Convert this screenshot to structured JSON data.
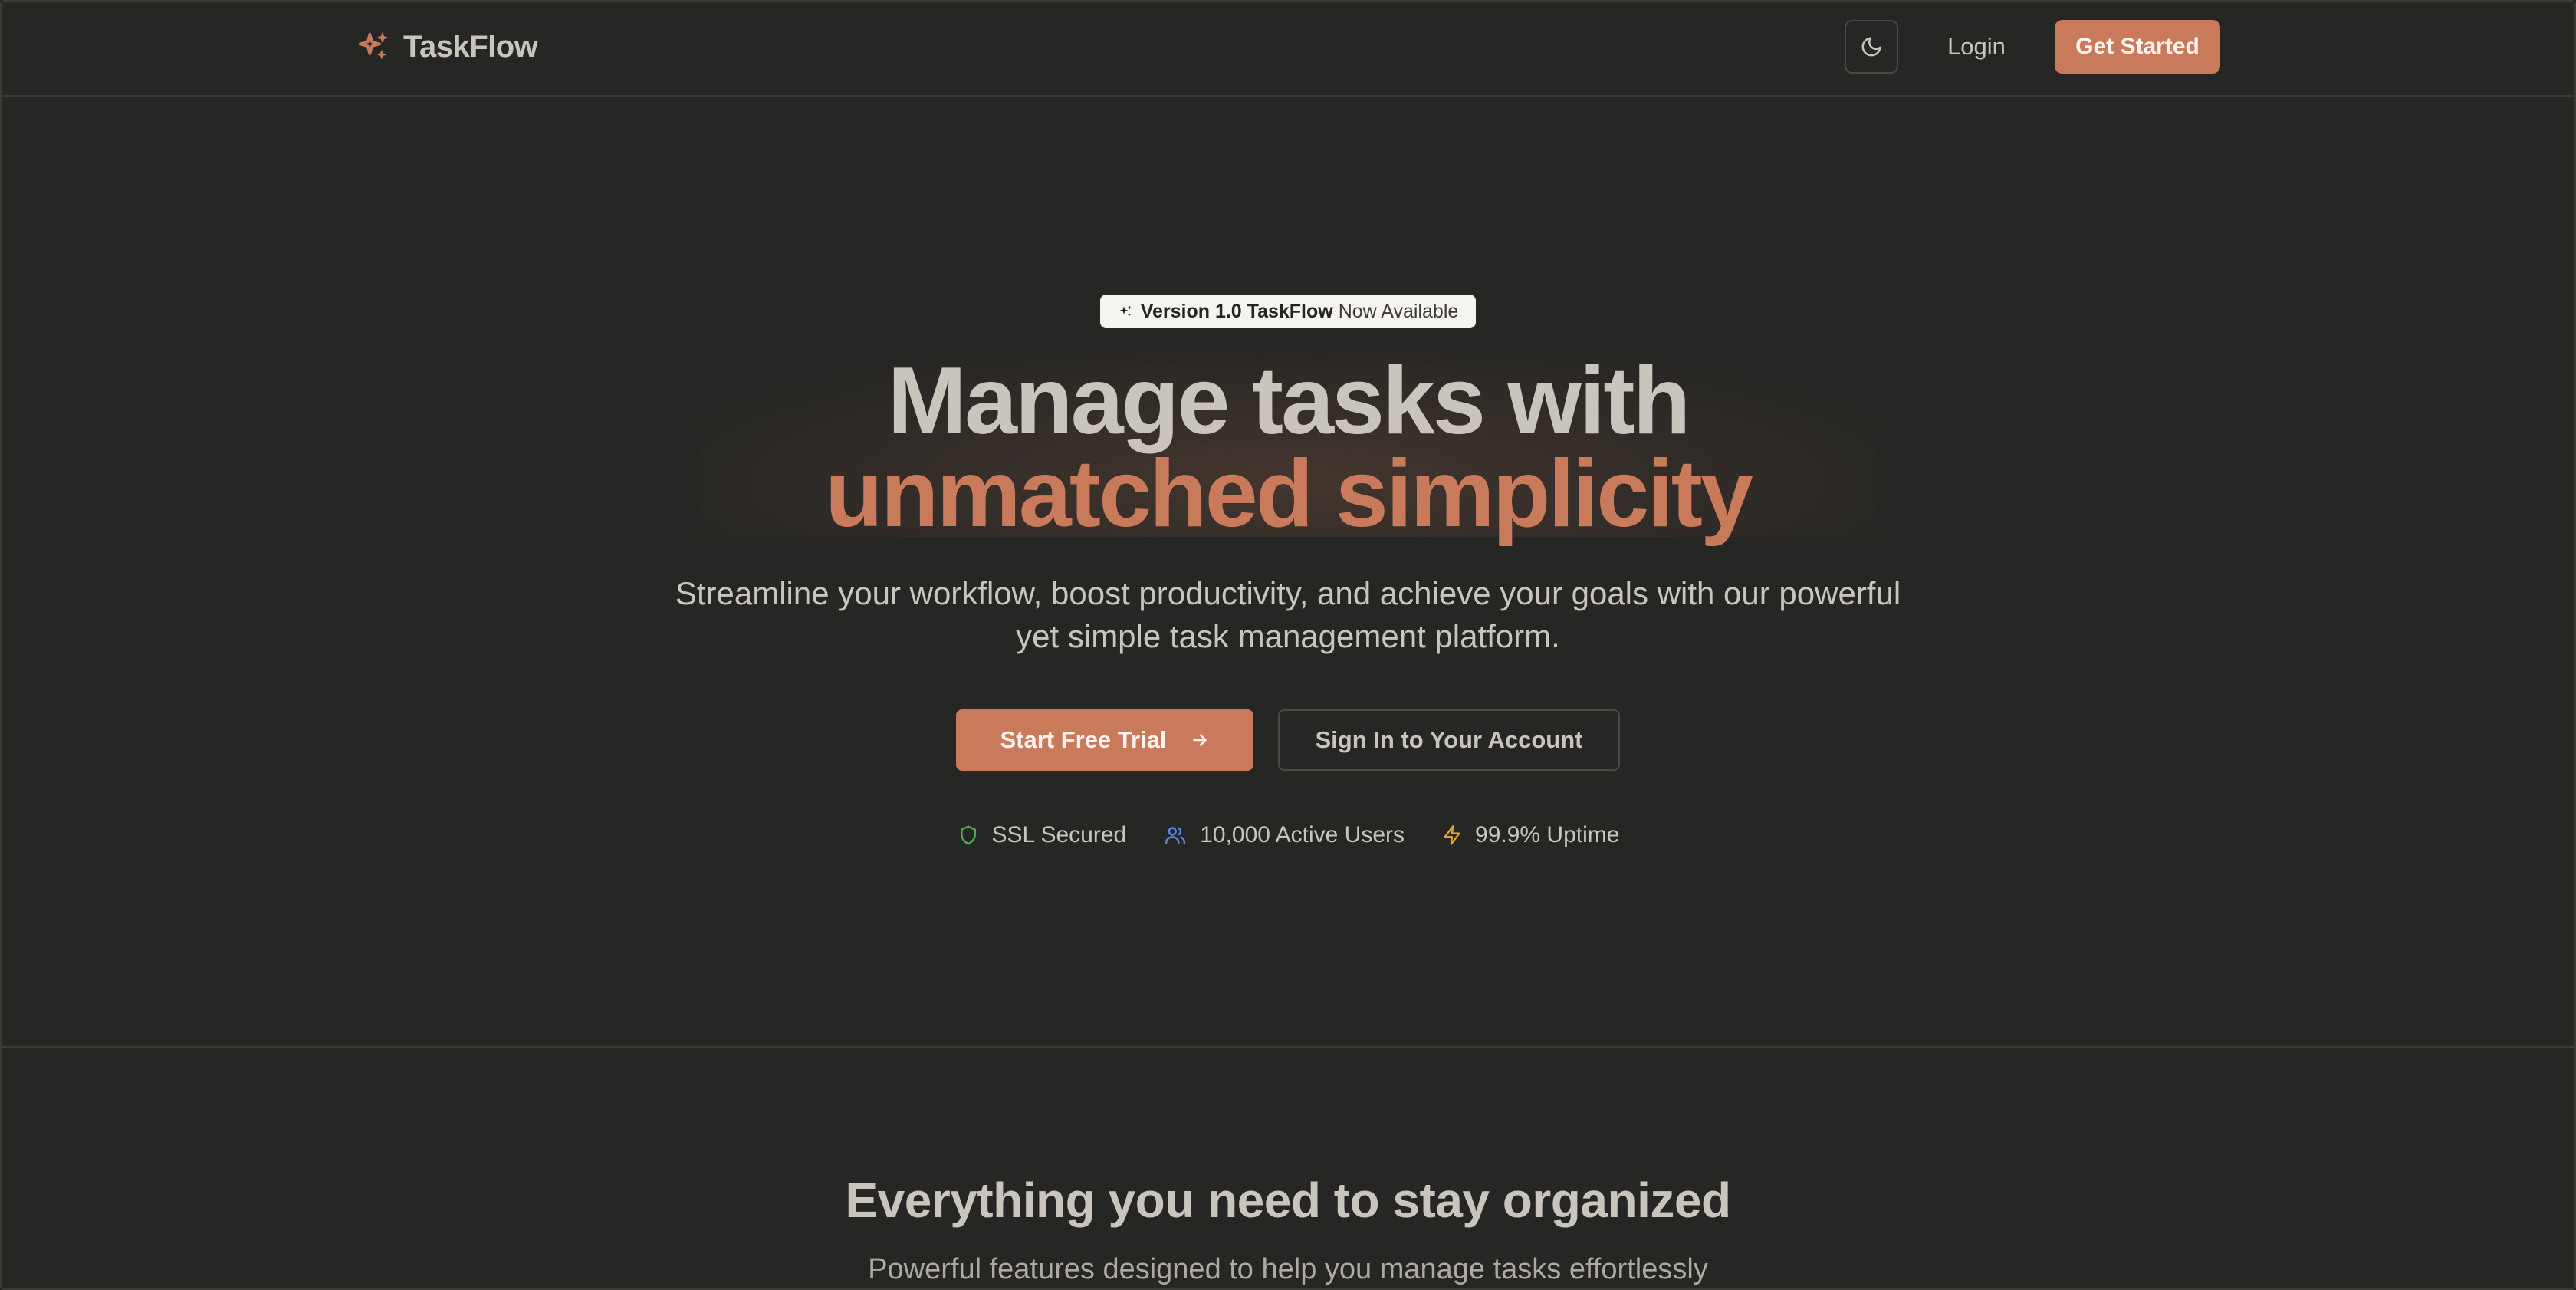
{
  "header": {
    "brand_name": "TaskFlow",
    "brand_icon": "sparkles-icon",
    "theme_toggle_icon": "moon-icon",
    "login_label": "Login",
    "get_started_label": "Get Started"
  },
  "hero": {
    "badge": {
      "icon": "sparkles-icon",
      "strong_text": "Version 1.0 TaskFlow",
      "light_text": "Now Available"
    },
    "headline_line1": "Manage tasks with",
    "headline_line2": "unmatched simplicity",
    "subtitle": "Streamline your workflow, boost productivity, and achieve your goals with our powerful yet simple task management platform.",
    "primary_cta": "Start Free Trial",
    "primary_cta_icon": "arrow-right-icon",
    "secondary_cta": "Sign In to Your Account",
    "trust": [
      {
        "icon": "shield-icon",
        "label": "SSL Secured",
        "color": "#4caf50"
      },
      {
        "icon": "users-icon",
        "label": "10,000 Active Users",
        "color": "#5b86e5"
      },
      {
        "icon": "lightning-icon",
        "label": "99.9% Uptime",
        "color": "#e5a630"
      }
    ]
  },
  "features": {
    "title": "Everything you need to stay organized",
    "subtitle": "Powerful features designed to help you manage tasks effortlessly"
  },
  "colors": {
    "background": "#262624",
    "accent": "#c97a5b",
    "text": "#c9c5bc",
    "border": "#3a3936"
  }
}
